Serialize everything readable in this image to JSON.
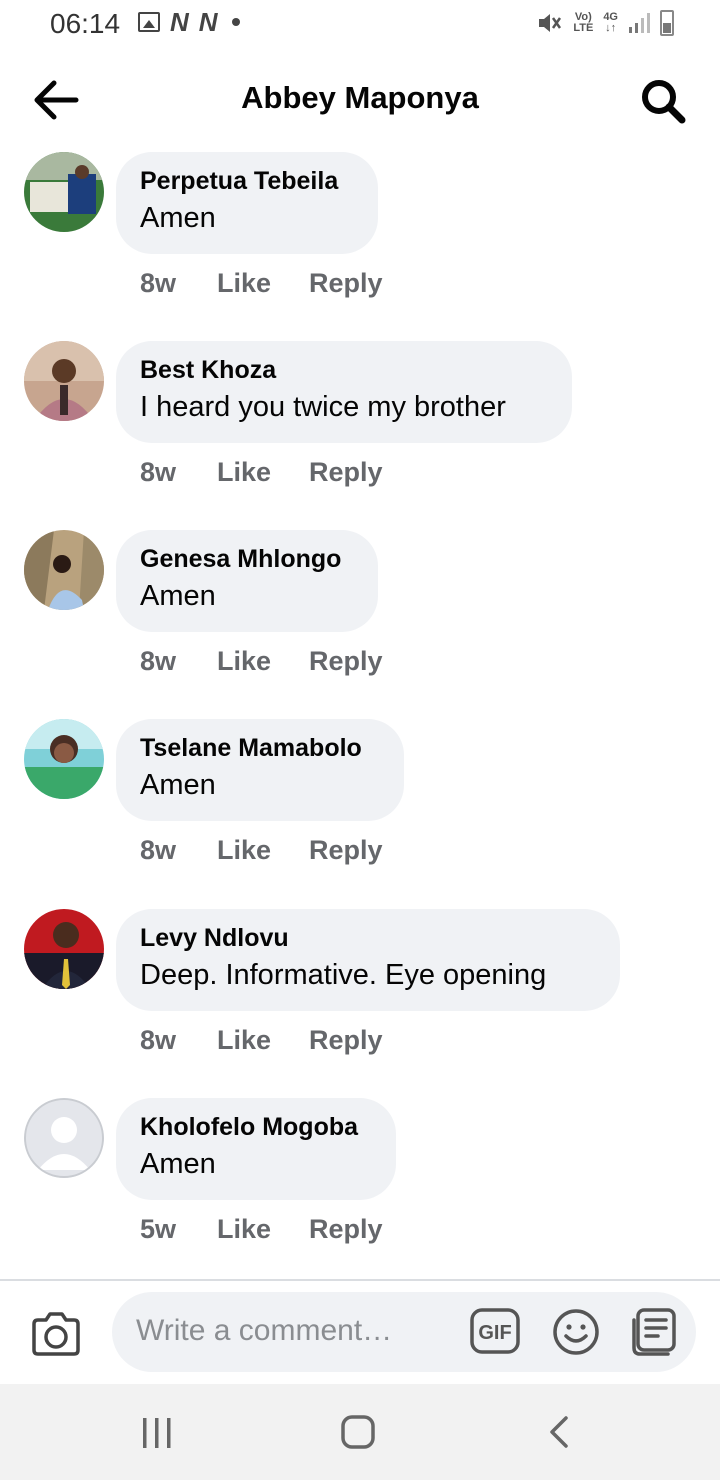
{
  "status_bar": {
    "time": "06:14",
    "network_label_top": "Vo)",
    "network_label_bottom": "LTE",
    "signal_label_top": "4G",
    "signal_label_bottom": "↓↑"
  },
  "header": {
    "title": "Abbey Maponya",
    "back_icon": "arrow-left-icon",
    "search_icon": "search-icon"
  },
  "comments": [
    {
      "name": "Perpetua Tebeila",
      "text": "Amen",
      "time": "8w",
      "like": "Like",
      "reply": "Reply"
    },
    {
      "name": "Best Khoza",
      "text": "I heard you twice my brother",
      "time": "8w",
      "like": "Like",
      "reply": "Reply"
    },
    {
      "name": "Genesa Mhlongo",
      "text": "Amen",
      "time": "8w",
      "like": "Like",
      "reply": "Reply"
    },
    {
      "name": "Tselane Mamabolo",
      "text": "Amen",
      "time": "8w",
      "like": "Like",
      "reply": "Reply"
    },
    {
      "name": "Levy Ndlovu",
      "text": "Deep. Informative. Eye opening",
      "time": "8w",
      "like": "Like",
      "reply": "Reply"
    },
    {
      "name": "Kholofelo Mogoba",
      "text": "Amen",
      "time": "5w",
      "like": "Like",
      "reply": "Reply"
    }
  ],
  "composer": {
    "placeholder": "Write a comment…",
    "gif_label": "GIF"
  },
  "colors": {
    "bubble": "#f0f2f5",
    "meta_text": "#65676b",
    "placeholder": "#8a8d91"
  }
}
